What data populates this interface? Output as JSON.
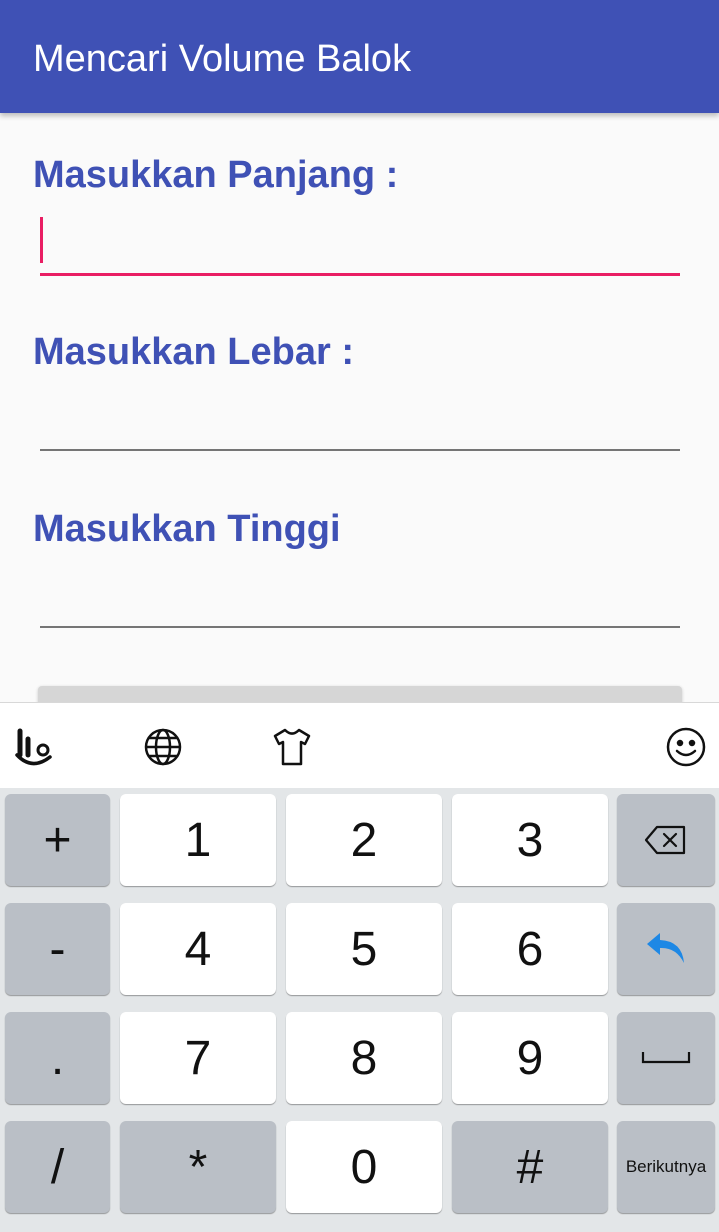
{
  "app_title": "Mencari Volume Balok",
  "form": {
    "panjang_label": "Masukkan Panjang :",
    "panjang_value": "",
    "lebar_label": "Masukkan Lebar :",
    "lebar_value": "",
    "tinggi_label": "Masukkan Tinggi",
    "tinggi_value": ""
  },
  "keyboard": {
    "toolbar_icons": [
      "touchpal-logo-icon",
      "globe-icon",
      "tshirt-theme-icon",
      "emoji-icon"
    ],
    "rows": [
      [
        "+",
        "1",
        "2",
        "3",
        "backspace"
      ],
      [
        "-",
        "4",
        "5",
        "6",
        "enter"
      ],
      [
        ".",
        "7",
        "8",
        "9",
        "space"
      ],
      [
        "/",
        "*",
        "0",
        "#",
        "Berikutnya"
      ]
    ],
    "keys": {
      "plus": "+",
      "one": "1",
      "two": "2",
      "three": "3",
      "minus": "-",
      "four": "4",
      "five": "5",
      "six": "6",
      "dot": ".",
      "seven": "7",
      "eight": "8",
      "nine": "9",
      "slash": "/",
      "star": "*",
      "zero": "0",
      "hash": "#",
      "next": "Berikutnya"
    },
    "accent_color": "#1e88e5"
  },
  "colors": {
    "primary": "#3f51b5",
    "field_focus": "#e91e63"
  }
}
